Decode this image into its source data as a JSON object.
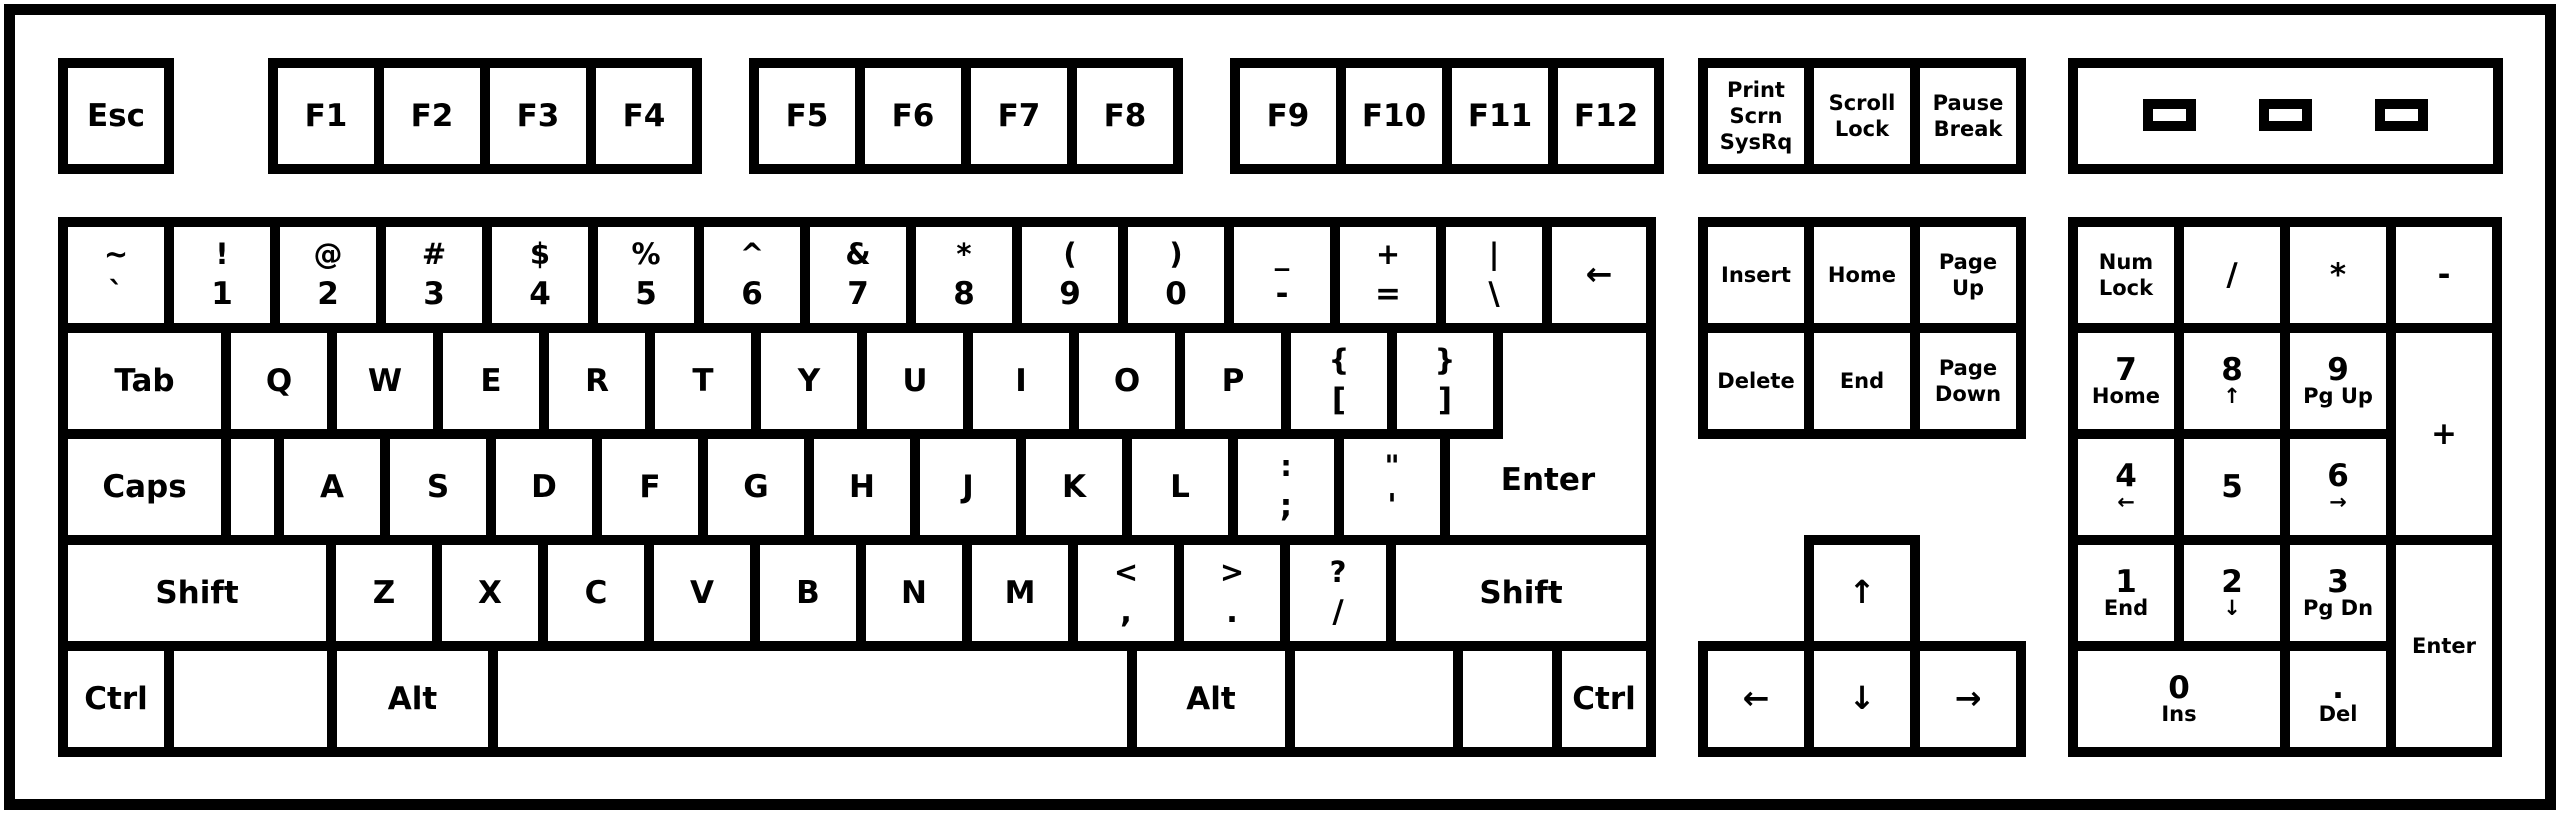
{
  "keyboard": {
    "function_row": {
      "esc": "Esc",
      "f_keys": [
        "F1",
        "F2",
        "F3",
        "F4",
        "F5",
        "F6",
        "F7",
        "F8",
        "F9",
        "F10",
        "F11",
        "F12"
      ],
      "print_screen": [
        "Print",
        "Scrn",
        "SysRq"
      ],
      "scroll_lock": [
        "Scroll",
        "Lock"
      ],
      "pause_break": [
        "Pause",
        "Break"
      ],
      "indicator_leds": [
        "num-lock-led",
        "caps-lock-led",
        "scroll-lock-led"
      ]
    },
    "number_row": [
      {
        "upper": "~",
        "lower": "`"
      },
      {
        "upper": "!",
        "lower": "1"
      },
      {
        "upper": "@",
        "lower": "2"
      },
      {
        "upper": "#",
        "lower": "3"
      },
      {
        "upper": "$",
        "lower": "4"
      },
      {
        "upper": "%",
        "lower": "5"
      },
      {
        "upper": "^",
        "lower": "6"
      },
      {
        "upper": "&",
        "lower": "7"
      },
      {
        "upper": "*",
        "lower": "8"
      },
      {
        "upper": "(",
        "lower": "9"
      },
      {
        "upper": ")",
        "lower": "0"
      },
      {
        "upper": "_",
        "lower": "-"
      },
      {
        "upper": "+",
        "lower": "="
      },
      {
        "upper": "|",
        "lower": "\\"
      }
    ],
    "backspace": "←",
    "tab_row": {
      "tab": "Tab",
      "letters": [
        "Q",
        "W",
        "E",
        "R",
        "T",
        "Y",
        "U",
        "I",
        "O",
        "P"
      ],
      "brackets": [
        {
          "upper": "{",
          "lower": "["
        },
        {
          "upper": "}",
          "lower": "]"
        }
      ]
    },
    "caps_row": {
      "caps": "Caps",
      "letters": [
        "A",
        "S",
        "D",
        "F",
        "G",
        "H",
        "J",
        "K",
        "L"
      ],
      "punct": [
        {
          "upper": ":",
          "lower": ";"
        },
        {
          "upper": "\"",
          "lower": "'"
        }
      ],
      "enter": "Enter"
    },
    "shift_row": {
      "left_shift": "Shift",
      "letters": [
        "Z",
        "X",
        "C",
        "V",
        "B",
        "N",
        "M"
      ],
      "punct": [
        {
          "upper": "<",
          "lower": ","
        },
        {
          "upper": ">",
          "lower": "."
        },
        {
          "upper": "?",
          "lower": "/"
        }
      ],
      "right_shift": "Shift"
    },
    "bottom_row": {
      "left_ctrl": "Ctrl",
      "left_alt": "Alt",
      "space": "",
      "right_alt": "Alt",
      "right_ctrl": "Ctrl"
    },
    "navigation": {
      "insert": "Insert",
      "home": "Home",
      "page_up": [
        "Page",
        "Up"
      ],
      "delete": "Delete",
      "end": "End",
      "page_down": [
        "Page",
        "Down"
      ]
    },
    "arrows": {
      "up": "↑",
      "left": "←",
      "down": "↓",
      "right": "→"
    },
    "numpad": {
      "num_lock": [
        "Num",
        "Lock"
      ],
      "divide": "/",
      "multiply": "*",
      "minus": "-",
      "plus": "+",
      "enter": "Enter",
      "keys": {
        "7": {
          "num": "7",
          "sub": "Home"
        },
        "8": {
          "num": "8",
          "sub": "↑"
        },
        "9": {
          "num": "9",
          "sub": "Pg Up"
        },
        "4": {
          "num": "4",
          "sub": "←"
        },
        "5": {
          "num": "5",
          "sub": ""
        },
        "6": {
          "num": "6",
          "sub": "→"
        },
        "1": {
          "num": "1",
          "sub": "End"
        },
        "2": {
          "num": "2",
          "sub": "↓"
        },
        "3": {
          "num": "3",
          "sub": "Pg Dn"
        },
        "0": {
          "num": "0",
          "sub": "Ins"
        },
        "dot": {
          "num": ".",
          "sub": "Del"
        }
      }
    }
  }
}
